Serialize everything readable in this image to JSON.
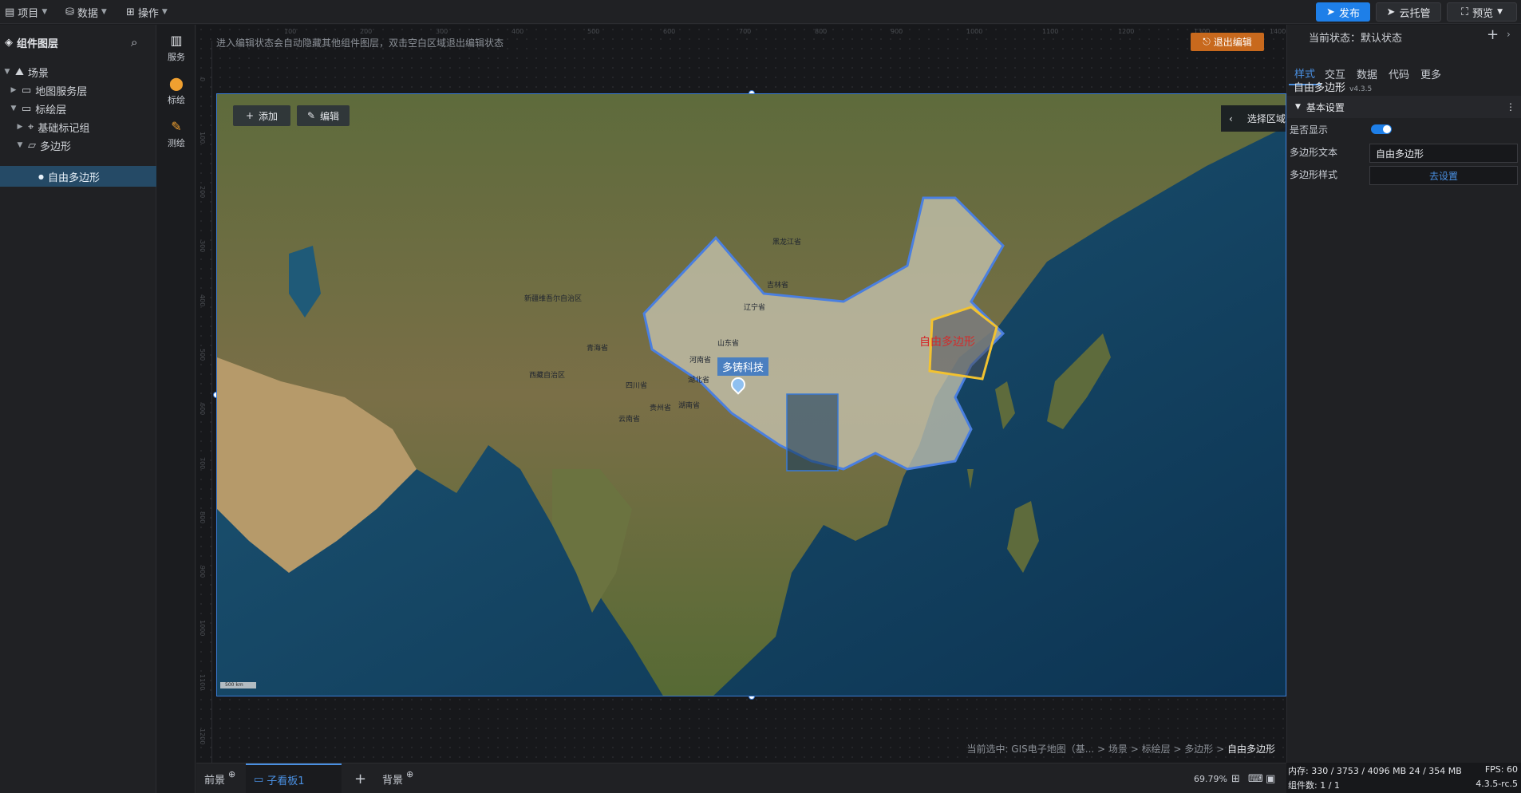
{
  "topbar": {
    "menus": [
      {
        "label": "项目",
        "icon": "file-icon"
      },
      {
        "label": "数据",
        "icon": "database-icon"
      },
      {
        "label": "操作",
        "icon": "grid-icon"
      }
    ],
    "publish_label": "发布",
    "cloud_label": "云托管",
    "preview_label": "预览"
  },
  "layers": {
    "title": "组件图层",
    "tree": [
      {
        "label": "场景",
        "icon": "scene-icon"
      },
      {
        "label": "地图服务层",
        "icon": "folder-icon"
      },
      {
        "label": "标绘层",
        "icon": "folder-icon"
      },
      {
        "label": "基础标记组",
        "icon": "marker-group-icon"
      },
      {
        "label": "多边形",
        "icon": "polygon-icon"
      },
      {
        "label": "自由多边形",
        "icon": "dot-icon"
      }
    ]
  },
  "tools": [
    {
      "label": "服务",
      "icon": "map-icon"
    },
    {
      "label": "标绘",
      "icon": "pin-icon"
    },
    {
      "label": "测绘",
      "icon": "measure-icon"
    }
  ],
  "canvas": {
    "hint": "进入编辑状态会自动隐藏其他组件图层，双击空白区域退出编辑状态",
    "exit_label": "退出编辑",
    "ruler_h": [
      "100",
      "200",
      "300",
      "400",
      "500",
      "600",
      "700",
      "800",
      "900",
      "1000",
      "1100",
      "1200",
      "1300",
      "1400"
    ],
    "ruler_v": [
      "0",
      "100",
      "200",
      "300",
      "400",
      "500",
      "600",
      "700",
      "800",
      "900",
      "1000",
      "1100",
      "1200"
    ],
    "map": {
      "add_label": "添加",
      "edit_label": "编辑",
      "select_region_label": "选择区域",
      "polygon_text": "自由多边形",
      "marker_label": "多铸科技",
      "scale_label": "500 km",
      "region_labels": [
        "新疆维吾尔自治区",
        "西藏自治区",
        "青海省",
        "四川省",
        "云南省",
        "贵州省",
        "湖南省",
        "湖北省",
        "河南省",
        "山东省",
        "辽宁省",
        "吉林省",
        "黑龙江省"
      ]
    },
    "breadcrumb": {
      "prefix": "当前选中: GIS电子地图（基...",
      "path": "> 场景 > 标绘层 > 多边形 >",
      "current": "自由多边形"
    }
  },
  "bottombar": {
    "tabs": [
      "前景",
      "子看板1",
      "背景"
    ],
    "zoom": "69.79%"
  },
  "rightpanel": {
    "state_label": "当前状态：默认状态",
    "tabs": [
      "样式",
      "交互",
      "数据",
      "代码",
      "更多"
    ],
    "component_name": "自由多边形",
    "version": "v4.3.5",
    "section_title": "基本设置",
    "props": {
      "visible_label": "是否显示",
      "visible_on": true,
      "text_label": "多边形文本",
      "text_value": "自由多边形",
      "style_label": "多边形样式",
      "style_action": "去设置"
    }
  },
  "status": {
    "memory": "内存:  330 / 3753 / 4096 MB  24 / 354 MB",
    "fps": "FPS:  60",
    "components": "组件数: 1 / 1",
    "version": "4.3.5-rc.5"
  },
  "colors": {
    "accent": "#4a90e2",
    "publish": "#1e7fe8",
    "exit": "#c8691d",
    "polygon_stroke": "#f2c230",
    "polygon_text": "#d42a2a",
    "china_outline": "#4a7fe0"
  }
}
